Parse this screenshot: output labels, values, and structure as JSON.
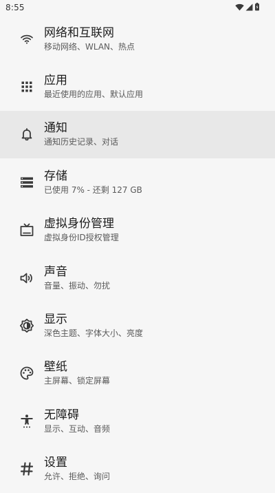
{
  "status_bar": {
    "time": "8:55",
    "icons": [
      "wifi-icon",
      "cell-signal-icon",
      "battery-icon"
    ]
  },
  "settings": [
    {
      "title": "网络和互联网",
      "subtitle": "移动网络、WLAN、热点",
      "icon": "wifi-icon"
    },
    {
      "title": "应用",
      "subtitle": "最近使用的应用、默认应用",
      "icon": "apps-grid-icon"
    },
    {
      "title": "通知",
      "subtitle": "通知历史记录、对话",
      "icon": "bell-icon"
    },
    {
      "title": "存储",
      "subtitle": "已使用 7% - 还剩 127 GB",
      "icon": "storage-icon"
    },
    {
      "title": "虚拟身份管理",
      "subtitle": "虚拟身份ID授权管理",
      "icon": "tv-icon"
    },
    {
      "title": "声音",
      "subtitle": "音量、振动、勿扰",
      "icon": "volume-icon"
    },
    {
      "title": "显示",
      "subtitle": "深色主题、字体大小、亮度",
      "icon": "brightness-icon"
    },
    {
      "title": "壁纸",
      "subtitle": "主屏幕、锁定屏幕",
      "icon": "palette-icon"
    },
    {
      "title": "无障碍",
      "subtitle": "显示、互动、音频",
      "icon": "accessibility-icon"
    },
    {
      "title": "设置",
      "subtitle": "允许、拒绝、询问",
      "icon": "hash-icon"
    }
  ],
  "highlighted_item": "通知",
  "colors": {
    "background": "#f6f6f6",
    "highlight": "#e8e8e8",
    "title": "#1c1c1c",
    "subtitle": "#5a5a5a",
    "icon": "#3a3a3a"
  }
}
